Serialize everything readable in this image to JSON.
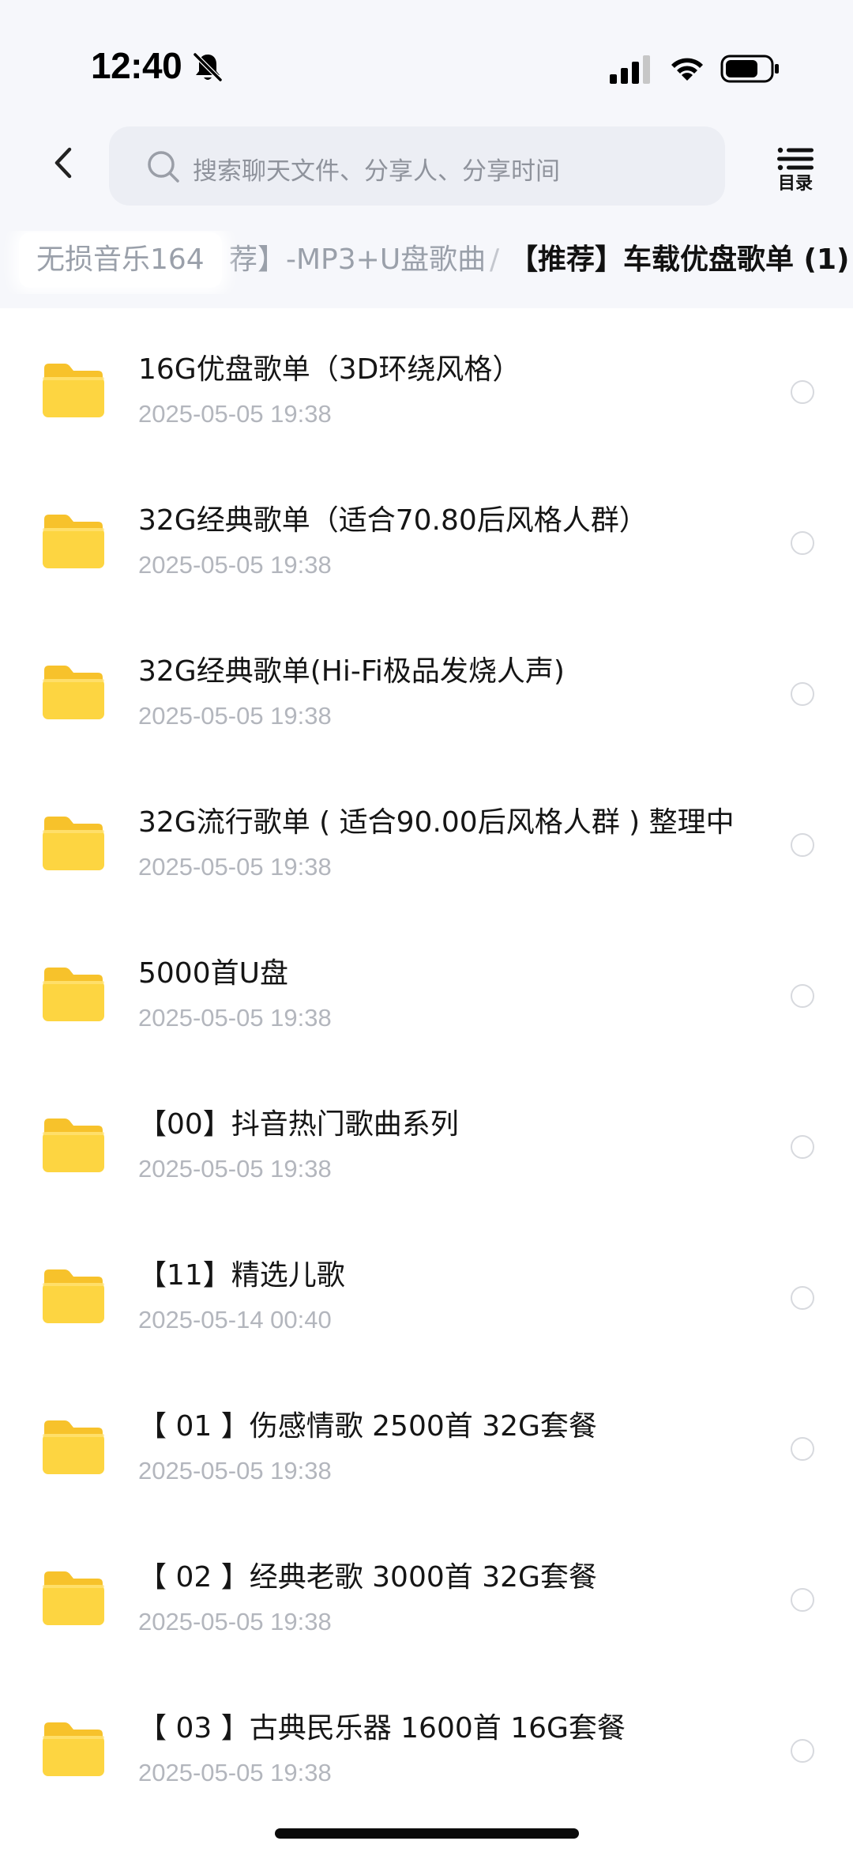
{
  "status_bar": {
    "time": "12:40",
    "mute_icon": "bell-slash-icon",
    "signal_icon": "cellular-signal-icon",
    "wifi_icon": "wifi-icon",
    "battery_icon": "battery-icon"
  },
  "header": {
    "back_icon": "chevron-left-icon",
    "search_placeholder": "搜索聊天文件、分享人、分享时间",
    "toc_label": "目录"
  },
  "breadcrumb": {
    "first": "无损音乐164",
    "middle": "荐】-MP3+U盘歌曲",
    "separator": "/",
    "current": "【推荐】车载优盘歌单 (1)"
  },
  "files": [
    {
      "name": "16G优盘歌单（3D环绕风格）",
      "date": "2025-05-05 19:38"
    },
    {
      "name": "32G经典歌单（适合70.80后风格人群）",
      "date": "2025-05-05 19:38"
    },
    {
      "name": "32G经典歌单(Hi-Fi极品发烧人声)",
      "date": "2025-05-05 19:38"
    },
    {
      "name": "32G流行歌单 ( 适合90.00后风格人群 ) 整理中",
      "date": "2025-05-05 19:38"
    },
    {
      "name": "5000首U盘",
      "date": "2025-05-05 19:38"
    },
    {
      "name": "【00】抖音热门歌曲系列",
      "date": "2025-05-05 19:38"
    },
    {
      "name": "【11】精选儿歌",
      "date": "2025-05-14 00:40"
    },
    {
      "name": "【 01 】伤感情歌 2500首 32G套餐",
      "date": "2025-05-05 19:38"
    },
    {
      "name": "【 02 】经典老歌 3000首 32G套餐",
      "date": "2025-05-05 19:38"
    },
    {
      "name": "【 03 】古典民乐器 1600首 16G套餐",
      "date": "2025-05-05 19:38"
    }
  ],
  "colors": {
    "folder_body": "#fdd541",
    "folder_tab": "#f7c22b",
    "muted_text": "#b3b6bd",
    "search_bg": "#eceef4"
  }
}
